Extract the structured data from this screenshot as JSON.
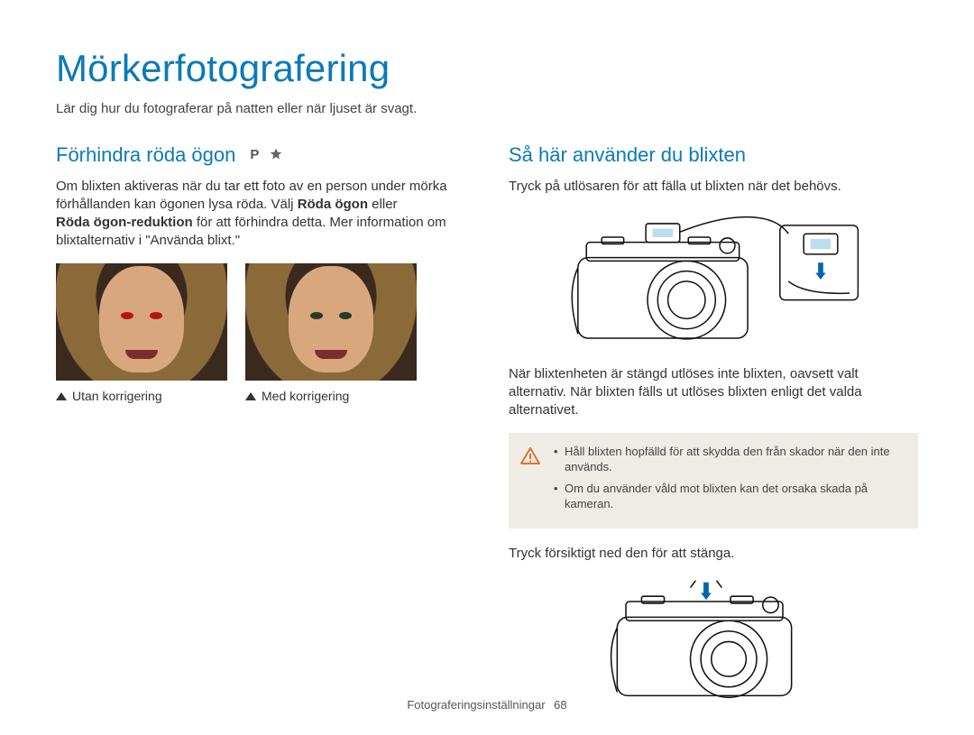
{
  "page": {
    "title": "Mörkerfotografering",
    "subtitle": "Lär dig hur du fotograferar på natten eller när ljuset är svagt."
  },
  "left": {
    "heading": "Förhindra röda ögon",
    "mode_p": "P",
    "body_parts": {
      "p1_a": "Om blixten aktiveras när du tar ett foto av en person under mörka förhållanden kan ögonen lysa röda. Välj ",
      "p1_bold1": "Röda ögon",
      "p1_b": " eller ",
      "p1_bold2": "Röda ögon-reduktion",
      "p1_c": " för att förhindra detta. Mer information om blixtalternativ i \"Använda blixt.\""
    },
    "captions": {
      "without": "Utan korrigering",
      "with": "Med korrigering"
    }
  },
  "right": {
    "heading": "Så här använder du blixten",
    "p1": "Tryck på utlösaren för att fälla ut blixten när det behövs.",
    "p2": "När blixtenheten är stängd utlöses inte blixten, oavsett valt alternativ. När blixten fälls ut utlöses blixten enligt det valda alternativet.",
    "warning": {
      "item1": "Håll blixten hopfälld för att skydda den från skador när den inte används.",
      "item2": "Om du använder våld mot blixten kan det orsaka skada på kameran."
    },
    "p3": "Tryck försiktigt ned den för att stänga."
  },
  "footer": {
    "section": "Fotograferingsinställningar",
    "page_number": "68"
  }
}
